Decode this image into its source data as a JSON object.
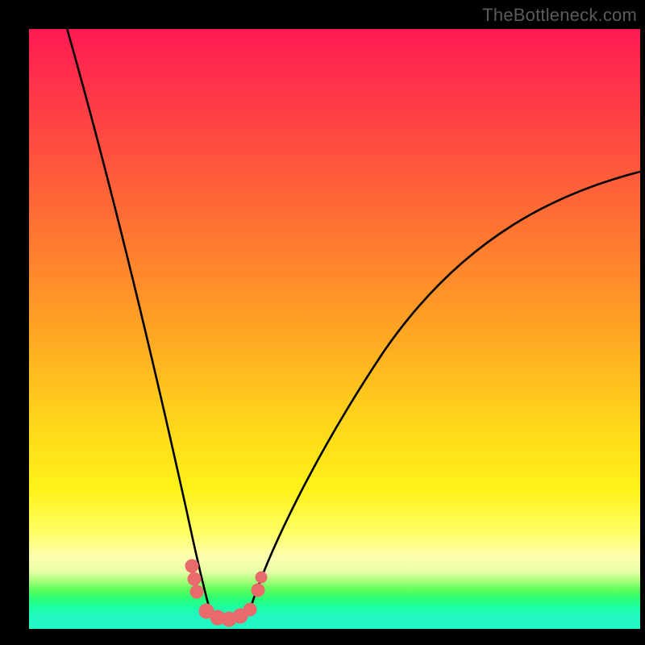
{
  "watermark": {
    "text": "TheBottleneck.com"
  },
  "chart_data": {
    "type": "line",
    "title": "",
    "xlabel": "",
    "ylabel": "",
    "xlim": [
      0,
      100
    ],
    "ylim": [
      0,
      100
    ],
    "grid": false,
    "legend": false,
    "background_gradient": {
      "direction": "vertical",
      "stops": [
        {
          "pos": 0.0,
          "color": "#ff1a52"
        },
        {
          "pos": 0.3,
          "color": "#ff6a35"
        },
        {
          "pos": 0.6,
          "color": "#ffd41a"
        },
        {
          "pos": 0.8,
          "color": "#fff31a"
        },
        {
          "pos": 0.9,
          "color": "#e8ffa8"
        },
        {
          "pos": 0.95,
          "color": "#2aff7a"
        },
        {
          "pos": 1.0,
          "color": "#22f7c6"
        }
      ]
    },
    "series": [
      {
        "name": "black-curve-left",
        "stroke": "#000000",
        "x": [
          6,
          10,
          14,
          18,
          20,
          22,
          24,
          25,
          26,
          27,
          28,
          29,
          30
        ],
        "y": [
          100,
          82,
          64,
          45,
          35,
          26,
          18,
          14,
          10,
          7,
          5,
          3,
          2
        ]
      },
      {
        "name": "black-curve-right",
        "stroke": "#000000",
        "x": [
          34,
          36,
          38,
          40,
          44,
          50,
          58,
          66,
          74,
          82,
          90,
          98,
          100
        ],
        "y": [
          2,
          4,
          7,
          10,
          16,
          25,
          36,
          46,
          55,
          62,
          69,
          74,
          76
        ]
      },
      {
        "name": "pink-markers",
        "stroke": "#e86a6a",
        "marker": "circle",
        "x": [
          26.5,
          27.0,
          28.5,
          30.0,
          31.5,
          33.0,
          34.5,
          36.0,
          36.5
        ],
        "y": [
          8.0,
          5.0,
          2.0,
          1.5,
          1.3,
          1.5,
          2.0,
          5.0,
          8.0
        ]
      }
    ],
    "annotations": []
  }
}
